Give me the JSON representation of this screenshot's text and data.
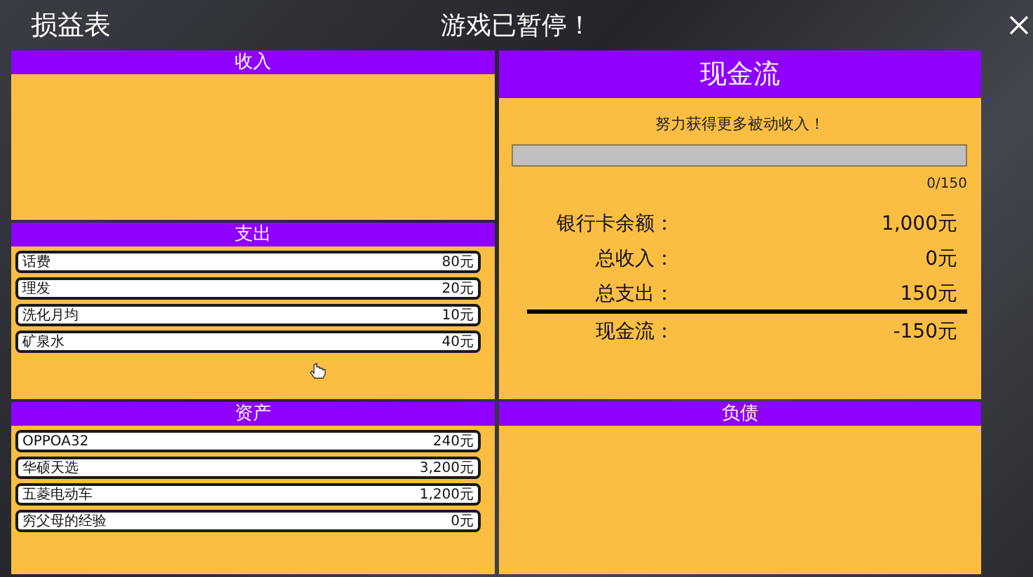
{
  "header": {
    "title": "损益表",
    "status": "游戏已暂停！"
  },
  "income": {
    "title": "收入"
  },
  "expenses": {
    "title": "支出",
    "items": [
      {
        "name": "话费",
        "amount": "80元"
      },
      {
        "name": "理发",
        "amount": "20元"
      },
      {
        "name": "洗化月均",
        "amount": "10元"
      },
      {
        "name": "矿泉水",
        "amount": "40元"
      }
    ]
  },
  "assets": {
    "title": "资产",
    "items": [
      {
        "name": "OPPOA32",
        "amount": "240元"
      },
      {
        "name": "华硕天选",
        "amount": "3,200元"
      },
      {
        "name": "五菱电动车",
        "amount": "1,200元"
      },
      {
        "name": "穷父母的经验",
        "amount": "0元"
      }
    ]
  },
  "cash_flow": {
    "title": "现金流",
    "hint": "努力获得更多被动收入！",
    "progress": {
      "level": 0,
      "reading": "0/150"
    },
    "rows": [
      {
        "label": "银行卡余额：",
        "value": "1,000元"
      },
      {
        "label": "总收入：",
        "value": "0元"
      },
      {
        "label": "总支出：",
        "value": "150元"
      }
    ],
    "total": {
      "label": "现金流：",
      "value": "-150元"
    }
  },
  "liabilities": {
    "title": "负债"
  }
}
